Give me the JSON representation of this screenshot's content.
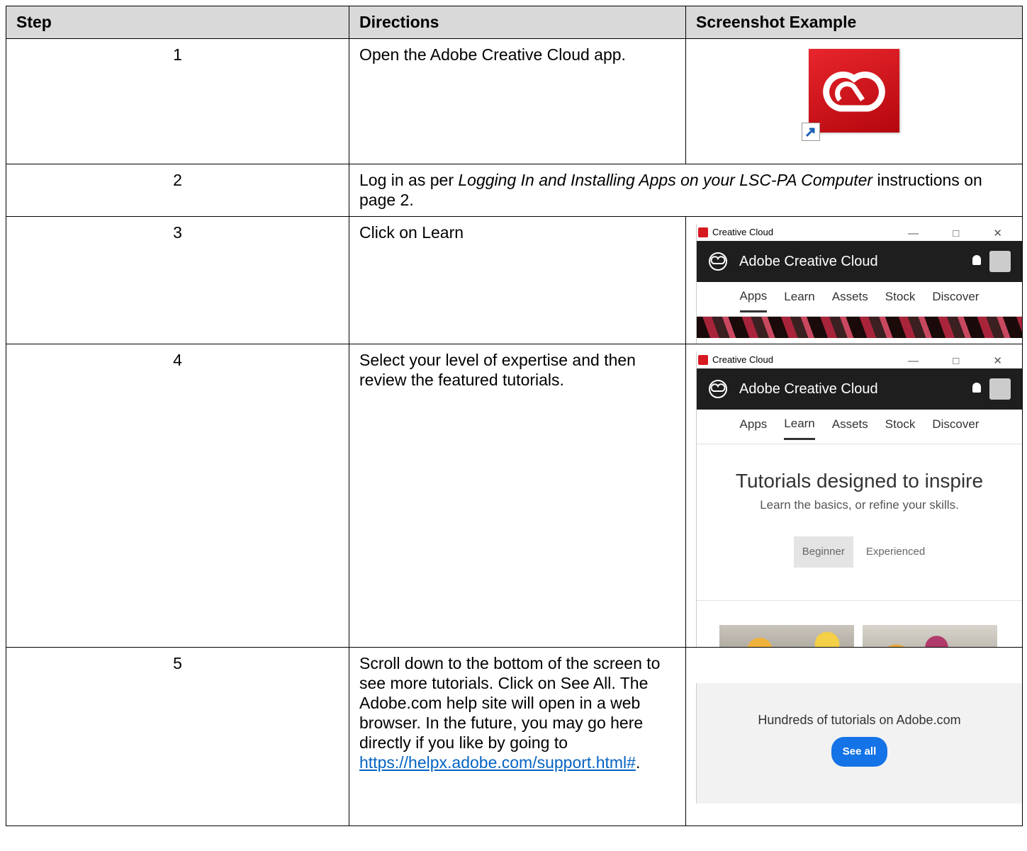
{
  "headers": [
    "Step",
    "Directions",
    "Screenshot Example"
  ],
  "rows": [
    {
      "step": "1",
      "directions": "Open the Adobe Creative Cloud app."
    },
    {
      "step": "2",
      "dir_a": "Log in as per ",
      "dir_italic": "Logging In and Installing Apps on your LSC-PA Computer",
      "dir_b": " instructions on page 2."
    },
    {
      "step": "3",
      "directions": "Click on Learn"
    },
    {
      "step": "4",
      "directions": "Select your level of expertise and then review the featured tutorials."
    },
    {
      "step": "5",
      "directions": "Scroll down to the bottom of the screen to see more tutorials. Click on See All. The Adobe.com help site will open in a web browser. In the future, you may go here directly if you like by going to ",
      "link": "https://helpx.adobe.com/support.html#",
      "after_link": "."
    }
  ],
  "cc_window": {
    "title": "Creative Cloud",
    "app_name": "Adobe Creative Cloud",
    "nav": [
      "Apps",
      "Learn",
      "Assets",
      "Stock",
      "Discover"
    ],
    "window_controls": "— □ ✕"
  },
  "tutorials": {
    "title": "Tutorials designed to inspire",
    "subtitle": "Learn the basics, or refine your skills.",
    "level_beginner": "Beginner",
    "level_experienced": "Experienced"
  },
  "see_all_panel": {
    "text": "Hundreds of tutorials on Adobe.com",
    "button": "See all"
  }
}
